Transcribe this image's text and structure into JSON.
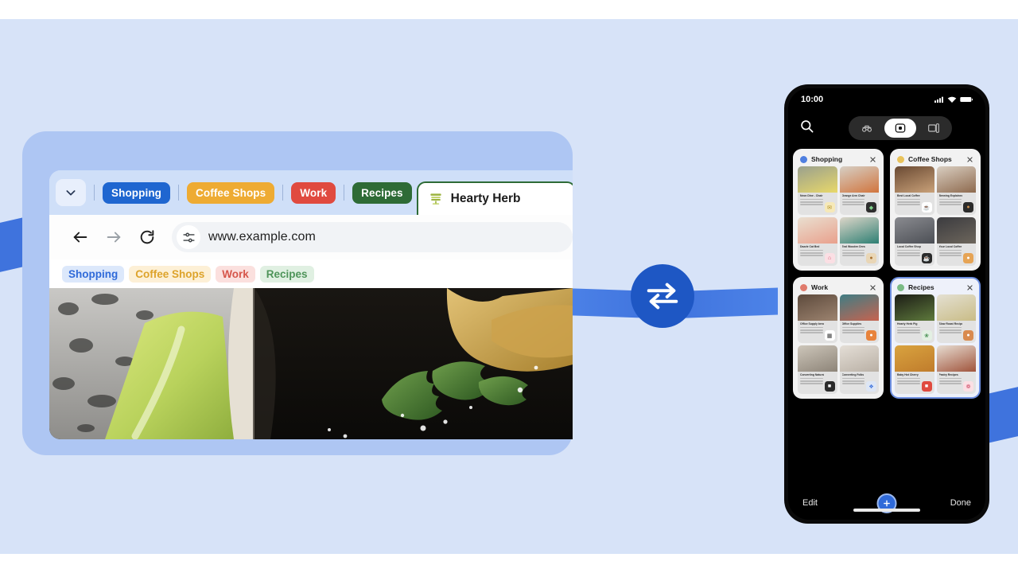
{
  "theme": {
    "stage_bg": "#d7e3f8",
    "band_blue": "#3f73dd",
    "sync_badge_blue": "#1e57c4",
    "browser_shell_blue": "#aec6f3",
    "phone_frame_black": "#0a0a0a",
    "selection_blue": "#6e8fe0",
    "add_button_blue": "#2f6ad9"
  },
  "sync_badge": {
    "icon": "sync-swap-arrows-icon"
  },
  "browser": {
    "tab_strip": {
      "menu_icon": "chevron-down-icon",
      "group_chips": [
        {
          "label": "Shopping",
          "bg": "#1f66d0",
          "fg": "#ffffff"
        },
        {
          "label": "Coffee Shops",
          "bg": "#eeab33",
          "fg": "#ffffff"
        },
        {
          "label": "Work",
          "bg": "#e04a3f",
          "fg": "#ffffff"
        },
        {
          "label": "Recipes",
          "bg": "#2e6b36",
          "fg": "#ffffff"
        }
      ],
      "active_tab": {
        "title": "Hearty Herb",
        "favicon": "recipe-grill-icon",
        "outline_color": "#2e6b36"
      }
    },
    "toolbar": {
      "back_icon": "back-arrow-icon",
      "forward_icon": "forward-arrow-icon",
      "reload_icon": "reload-icon",
      "tune_icon": "tune-sliders-icon",
      "url": "www.example.com"
    },
    "bookmarks": [
      {
        "label": "Shopping",
        "bg": "#dce8fb",
        "fg": "#2f6ad9"
      },
      {
        "label": "Coffee Shops",
        "bg": "#fdf0d6",
        "fg": "#dda32b"
      },
      {
        "label": "Work",
        "bg": "#fbe0de",
        "fg": "#d6554a"
      },
      {
        "label": "Recipes",
        "bg": "#e0f0e2",
        "fg": "#4e9459"
      }
    ],
    "page": {
      "alt": "close-up photo of lime wedge, dark drink and cilantro leaf"
    }
  },
  "phone": {
    "status": {
      "clock": "10:00",
      "signal_icon": "cellular-signal-icon",
      "wifi_icon": "wifi-icon",
      "battery_icon": "battery-icon"
    },
    "topbar": {
      "search_icon": "search-icon",
      "modes": [
        {
          "name": "incognito-mode",
          "icon": "incognito-mask-icon",
          "active": false
        },
        {
          "name": "tab-groups-mode",
          "icon": "tab-groups-icon",
          "active": true
        },
        {
          "name": "other-devices-mode",
          "icon": "devices-icon",
          "active": false
        }
      ]
    },
    "groups": [
      {
        "name": "Shopping",
        "dot": "#4f7fe0",
        "selected": false,
        "close_icon": "close-icon",
        "tabs": [
          {
            "title": "Neon Dine - Chair",
            "favicon_bg": "#f6e9b8",
            "favicon_glyph": "✉",
            "favicon_fg": "#b08f25",
            "img_top": "#9aa08e",
            "img_bottom": "#e8d86a"
          },
          {
            "title": "Orange Arm Chair",
            "favicon_bg": "#2e2e2e",
            "favicon_glyph": "◆",
            "favicon_fg": "#7fd18a",
            "img_top": "#d6cfc5",
            "img_bottom": "#d1753e"
          },
          {
            "title": "Dazzle Cat Bed",
            "favicon_bg": "#fbdfe4",
            "favicon_glyph": "⌂",
            "favicon_fg": "#d2566f",
            "img_top": "#e9dfd0",
            "img_bottom": "#e9a08c"
          },
          {
            "title": "Teal Wooden Dresser",
            "favicon_bg": "#e9d6b6",
            "favicon_glyph": "●",
            "favicon_fg": "#a8702f",
            "img_top": "#ddd6c9",
            "img_bottom": "#2e7f73"
          }
        ]
      },
      {
        "name": "Coffee Shops",
        "dot": "#e9c35b",
        "selected": false,
        "close_icon": "close-icon",
        "tabs": [
          {
            "title": "Best Local Coffee",
            "favicon_bg": "#ffffff",
            "favicon_glyph": "☕",
            "favicon_fg": "#4a2d1c",
            "img_top": "#6a4a33",
            "img_bottom": "#c9a179"
          },
          {
            "title": "Brewing Explained",
            "favicon_bg": "#2b2b2b",
            "favicon_glyph": "●",
            "favicon_fg": "#c98e4e",
            "img_top": "#d9cec1",
            "img_bottom": "#8e6a4e"
          },
          {
            "title": "Local Coffee Shops",
            "favicon_bg": "#2b2b2b",
            "favicon_glyph": "☕",
            "favicon_fg": "#ffffff",
            "img_top": "#8a8b90",
            "img_bottom": "#4c4f55"
          },
          {
            "title": "Your Local Coffee",
            "favicon_bg": "#e6a455",
            "favicon_glyph": "●",
            "favicon_fg": "#ffffff",
            "img_top": "#3b3b3f",
            "img_bottom": "#6d665c"
          }
        ]
      },
      {
        "name": "Work",
        "dot": "#e07b6c",
        "selected": false,
        "close_icon": "close-icon",
        "tabs": [
          {
            "title": "Office Supply bench",
            "favicon_bg": "#ffffff",
            "favicon_glyph": "▦",
            "favicon_fg": "#3a3a3a",
            "img_top": "#5d4a3c",
            "img_bottom": "#9d8470"
          },
          {
            "title": "Office Supplies",
            "favicon_bg": "#e8833c",
            "favicon_glyph": "●",
            "favicon_fg": "#ffffff",
            "img_top": "#3f7d84",
            "img_bottom": "#c7634f"
          },
          {
            "title": "Converting Natural",
            "favicon_bg": "#2b2b2b",
            "favicon_glyph": "■",
            "favicon_fg": "#ffffff",
            "img_top": "#cdc6ba",
            "img_bottom": "#8d8478"
          },
          {
            "title": "Converting Folks",
            "favicon_bg": "#dde6f5",
            "favicon_glyph": "❖",
            "favicon_fg": "#3f73dd",
            "img_top": "#e4ded6",
            "img_bottom": "#b9b0a5"
          }
        ]
      },
      {
        "name": "Recipes",
        "dot": "#7bbb85",
        "selected": true,
        "close_icon": "close-icon",
        "tabs": [
          {
            "title": "Hearty Herb Pig",
            "favicon_bg": "#e3f0e3",
            "favicon_glyph": "❀",
            "favicon_fg": "#4e9459",
            "img_top": "#1c1c16",
            "img_bottom": "#5e7a3c"
          },
          {
            "title": "Slow Roast Recipes",
            "favicon_bg": "#d98a4e",
            "favicon_glyph": "●",
            "favicon_fg": "#ffffff",
            "img_top": "#e4e0d2",
            "img_bottom": "#c9bc86"
          },
          {
            "title": "Baby Hot Cherry",
            "favicon_bg": "#e04a3f",
            "favicon_glyph": "■",
            "favicon_fg": "#ffffff",
            "img_top": "#d9a33f",
            "img_bottom": "#c07c2c"
          },
          {
            "title": "Pastry Recipes",
            "favicon_bg": "#fbdfe4",
            "favicon_glyph": "❁",
            "favicon_fg": "#d2566f",
            "img_top": "#e7ddd2",
            "img_bottom": "#a0543c"
          }
        ]
      }
    ],
    "bottombar": {
      "edit_label": "Edit",
      "add_icon": "plus-icon",
      "done_label": "Done"
    }
  }
}
